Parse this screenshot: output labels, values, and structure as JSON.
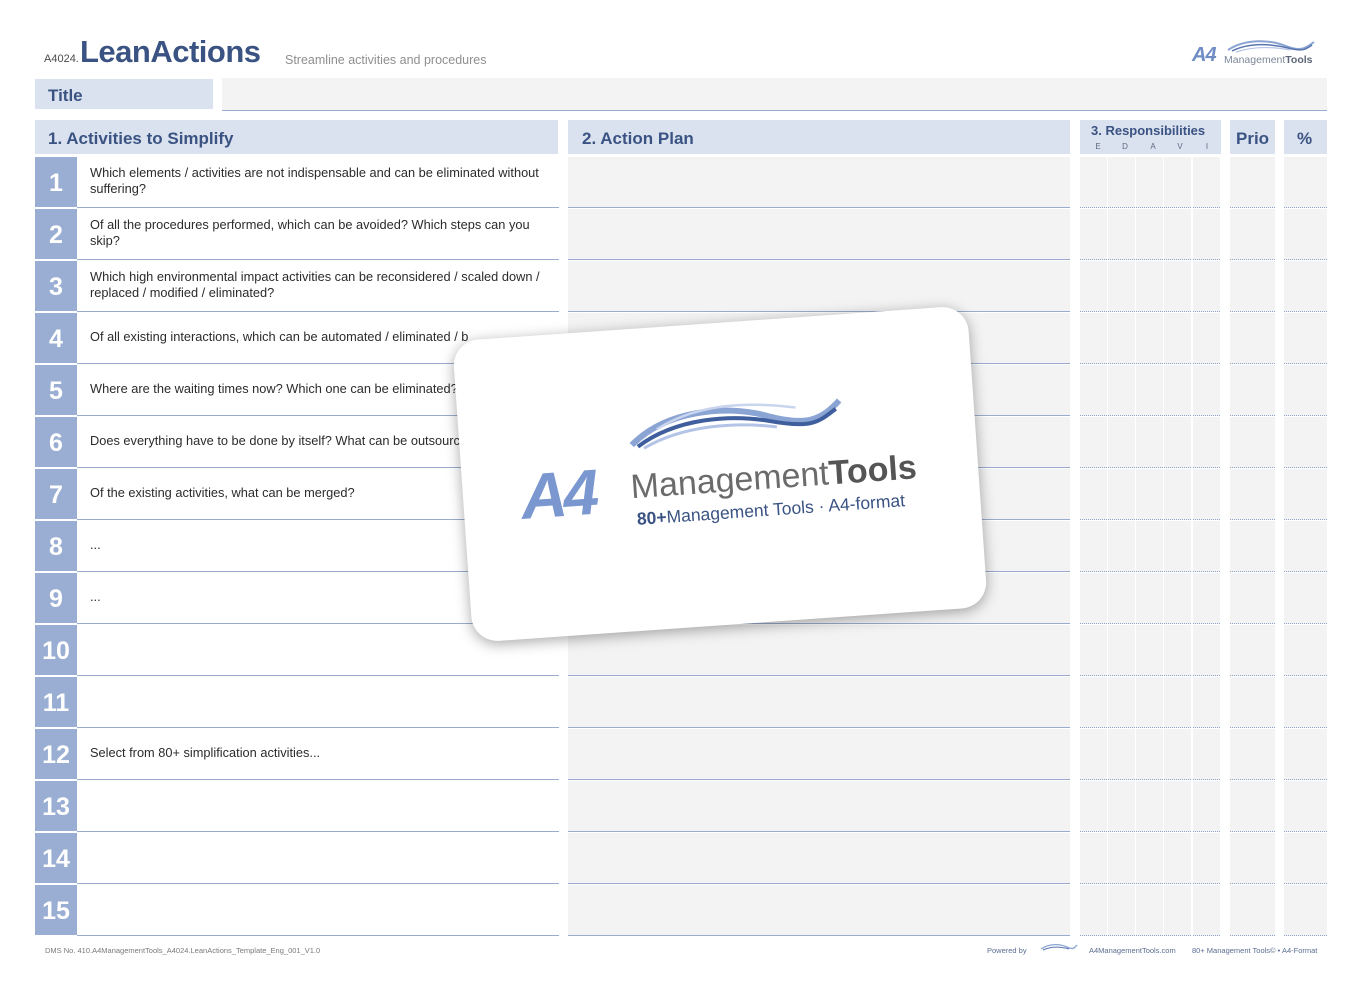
{
  "header": {
    "code": "A4024.",
    "title": "LeanActions",
    "subtitle": "Streamline activities and procedures",
    "brand_a4": "A4",
    "brand_mgmt": "Management",
    "brand_tools": "Tools"
  },
  "title_field": {
    "label": "Title",
    "value": ""
  },
  "columns": {
    "activities": "1. Activities to Simplify",
    "action_plan": "2. Action Plan",
    "responsibilities": "3. Responsibilities",
    "raci": [
      "E",
      "D",
      "A",
      "V",
      "I"
    ],
    "prio": "Prio",
    "percent": "%"
  },
  "rows": [
    {
      "num": "1",
      "text": "Which elements / activities are not indispensable and can be eliminated without suffering?"
    },
    {
      "num": "2",
      "text": "Of all the procedures performed, which can be avoided? Which steps can you skip?"
    },
    {
      "num": "3",
      "text": "Which high environmental impact activities can be reconsidered / scaled down / replaced / modified / eliminated?"
    },
    {
      "num": "4",
      "text": "Of all existing interactions, which can be automated / eliminated / b"
    },
    {
      "num": "5",
      "text": "Where are the waiting times now? Which one can be eliminated?"
    },
    {
      "num": "6",
      "text": "Does everything have to be done by itself? What can be outsourc"
    },
    {
      "num": "7",
      "text": "Of the existing activities, what can be merged?"
    },
    {
      "num": "8",
      "text": "..."
    },
    {
      "num": "9",
      "text": "..."
    },
    {
      "num": "10",
      "text": ""
    },
    {
      "num": "11",
      "text": ""
    },
    {
      "num": "12",
      "text": "Select from 80+ simplification activities..."
    },
    {
      "num": "13",
      "text": ""
    },
    {
      "num": "14",
      "text": ""
    },
    {
      "num": "15",
      "text": ""
    }
  ],
  "overlay_card": {
    "logo_a4": "A4",
    "logo_mgmt": "Management",
    "logo_tools": "Tools",
    "tag_count": "80+",
    "tag_text": "Management Tools · A4-format"
  },
  "footer": {
    "dms": "DMS No. 410.A4ManagementTools_A4024.LeanActions_Template_Eng_001_V1.0",
    "powered_by": "Powered by",
    "site": "A4ManagementTools.com",
    "format": "80+ Management Tools© • A4-Format"
  },
  "colors": {
    "accent": "#3a5383",
    "number_box": "#9aaed3",
    "header_bg": "#dbe2ef",
    "cell_bg": "#f3f3f3"
  }
}
